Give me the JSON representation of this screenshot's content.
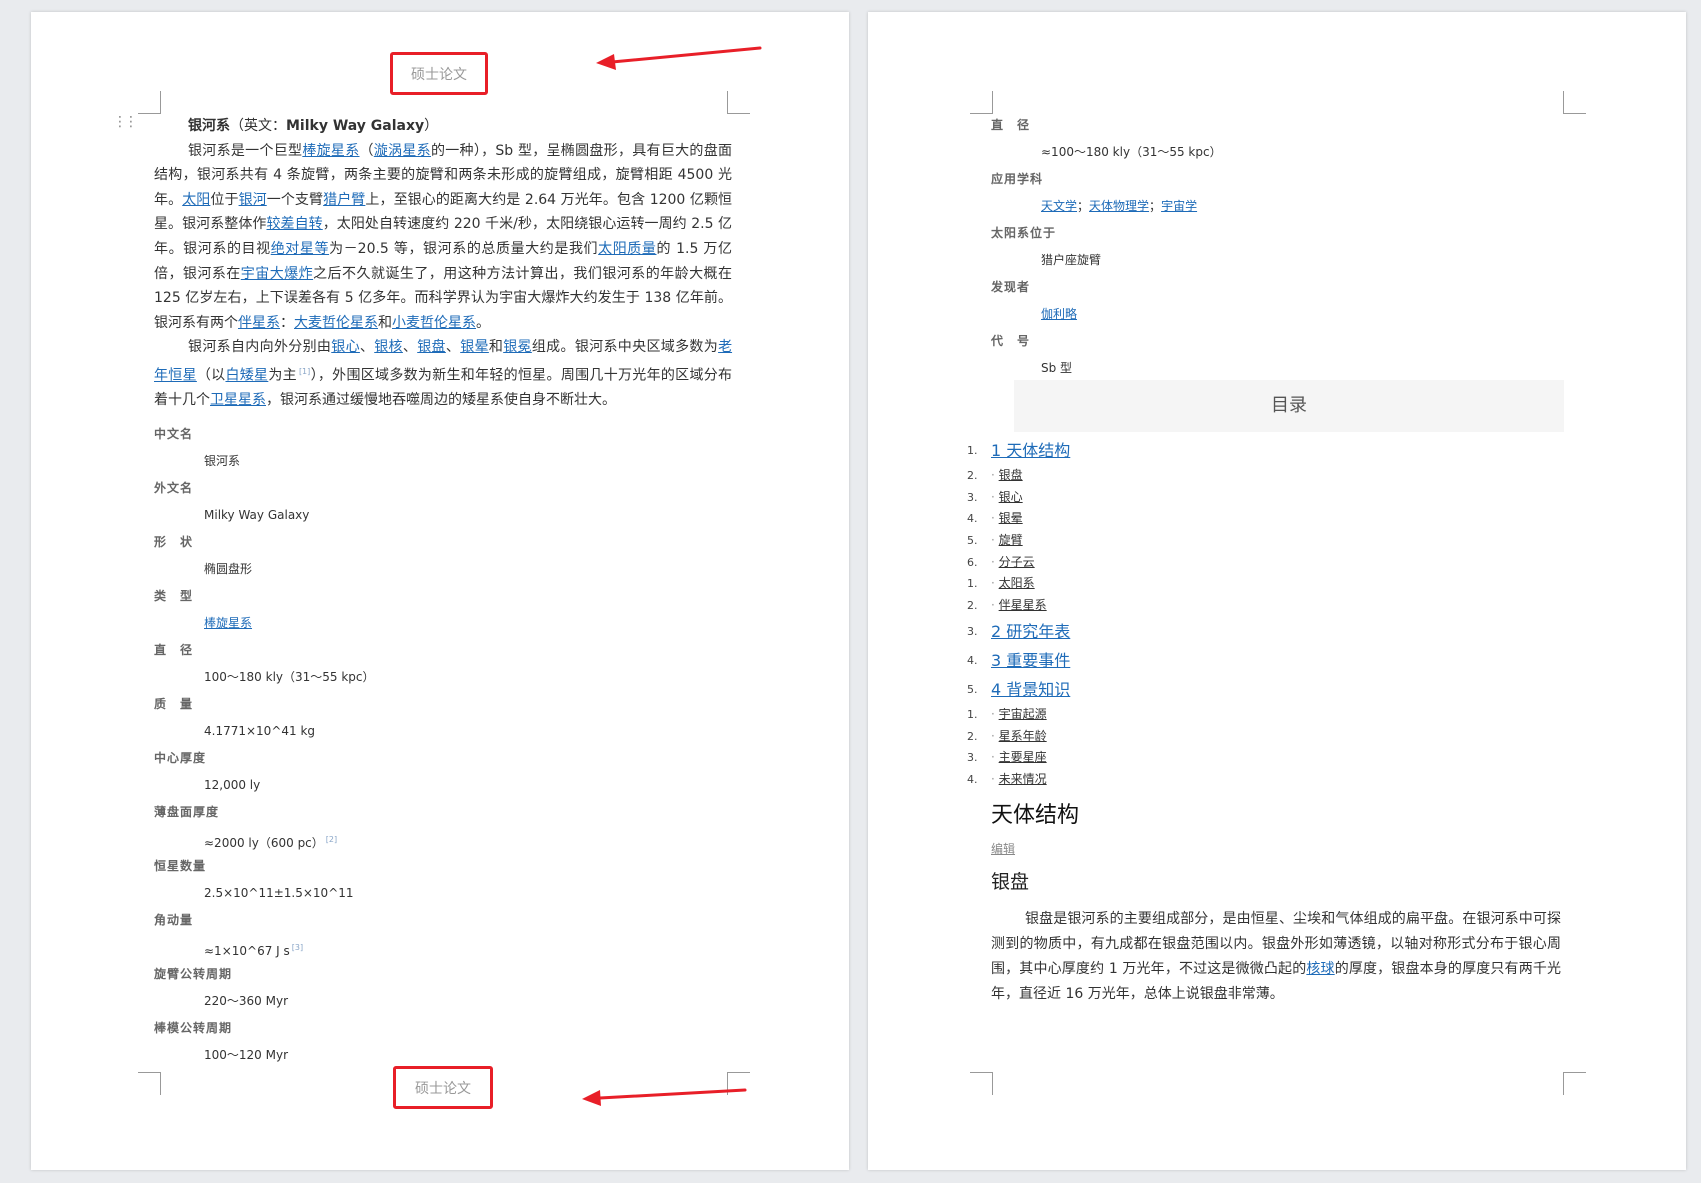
{
  "header_label": "硕士论文",
  "footer_label": "硕士论文",
  "intro": {
    "title_bold": "银河系",
    "title_rest": "（英文：",
    "title_en": "Milky Way Galaxy",
    "title_close": "）",
    "p1": [
      {
        "t": "银河系是一个巨型"
      },
      {
        "t": "棒旋星系",
        "link": true
      },
      {
        "t": "（"
      },
      {
        "t": "漩涡星系",
        "link": true
      },
      {
        "t": "的一种），Sb 型，呈椭圆盘形，具有巨大的盘面结构，银河系共有 4 条旋臂，两条主要的旋臂和两条未形成的旋臂组成，旋臂相距 4500 光年。"
      },
      {
        "t": "太阳",
        "link": true
      },
      {
        "t": "位于"
      },
      {
        "t": "银河",
        "link": true
      },
      {
        "t": "一个支臂"
      },
      {
        "t": "猎户臂",
        "link": true
      },
      {
        "t": "上，至银心的距离大约是 2.64 万光年。包含 1200 亿颗恒星。银河系整体作"
      },
      {
        "t": "较差自转",
        "link": true
      },
      {
        "t": "，太阳处自转速度约 220 千米/秒，太阳绕银心运转一周约 2.5 亿年。银河系的目视"
      },
      {
        "t": "绝对星等",
        "link": true
      },
      {
        "t": "为－20.5 等，银河系的总质量大约是我们"
      },
      {
        "t": "太阳质量",
        "link": true
      },
      {
        "t": "的 1.5 万亿倍，银河系在"
      },
      {
        "t": "宇宙大爆炸",
        "link": true
      },
      {
        "t": "之后不久就诞生了，用这种方法计算出，我们银河系的年龄大概在 125 亿岁左右，上下误差各有 5 亿多年。而科学界认为宇宙大爆炸大约发生于 138 亿年前。银河系有两个"
      },
      {
        "t": "伴星系",
        "link": true
      },
      {
        "t": "："
      },
      {
        "t": "大麦哲伦星系",
        "link": true
      },
      {
        "t": "和"
      },
      {
        "t": "小麦哲伦星系",
        "link": true
      },
      {
        "t": "。"
      }
    ],
    "p2": [
      {
        "t": "银河系自内向外分别由"
      },
      {
        "t": "银心",
        "link": true
      },
      {
        "t": "、"
      },
      {
        "t": "银核",
        "link": true
      },
      {
        "t": "、"
      },
      {
        "t": "银盘",
        "link": true
      },
      {
        "t": "、"
      },
      {
        "t": "银晕",
        "link": true
      },
      {
        "t": "和"
      },
      {
        "t": "银冕",
        "link": true
      },
      {
        "t": "组成。银河系中央区域多数为"
      },
      {
        "t": "老年恒星",
        "link": true
      },
      {
        "t": "（以"
      },
      {
        "t": "白矮星",
        "link": true
      },
      {
        "t": "为主"
      },
      {
        "t": "[1]",
        "sup": true
      },
      {
        "t": "），外围区域多数为新生和年轻的恒星。周围几十万光年的区域分布着十几个"
      },
      {
        "t": "卫星星系",
        "link": true
      },
      {
        "t": "，银河系通过缓慢地吞噬周边的矮星系使自身不断壮大。"
      }
    ]
  },
  "info_left": [
    {
      "label": "中文名",
      "value": "银河系"
    },
    {
      "label": "外文名",
      "value": "Milky  Way  Galaxy"
    },
    {
      "label": "形　状",
      "value": "椭圆盘形"
    },
    {
      "label": "类　型",
      "value": "棒旋星系",
      "link": true
    },
    {
      "label": "直　径",
      "value": "100～180  kly（31～55  kpc）"
    },
    {
      "label": "质　量",
      "value": "4.1771×10^41  kg"
    },
    {
      "label": "中心厚度",
      "value": "12,000  ly"
    },
    {
      "label": "薄盘面厚度",
      "value": "≈2000  ly（600  pc）",
      "sup": "[2]"
    },
    {
      "label": "恒星数量",
      "value": "2.5×10^11±1.5×10^11"
    },
    {
      "label": "角动量",
      "value": "≈1×10^67  J  s",
      "sup": "[3]"
    },
    {
      "label": "旋臂公转周期",
      "value": "220～360  Myr"
    },
    {
      "label": "棒模公转周期",
      "value": "100～120  Myr"
    }
  ],
  "info_right": [
    {
      "label": "直　径",
      "value": "≈100～180  kly（31～55  kpc）"
    },
    {
      "label": "应用学科",
      "links": [
        "天文学",
        "天体物理学",
        "宇宙学"
      ]
    },
    {
      "label": "太阳系位于",
      "value": "猎户座旋臂"
    },
    {
      "label": "发现者",
      "value": "伽利略",
      "link": true
    },
    {
      "label": "代　号",
      "value": "Sb 型"
    }
  ],
  "toc": {
    "title": "目录",
    "items": [
      {
        "num": "1.",
        "text": "1 天体结构",
        "main": true
      },
      {
        "num": "2.",
        "text": "银盘"
      },
      {
        "num": "3.",
        "text": "银心"
      },
      {
        "num": "4.",
        "text": "银晕"
      },
      {
        "num": "5.",
        "text": "旋臂"
      },
      {
        "num": "6.",
        "text": "分子云"
      },
      {
        "num": "1.",
        "text": "太阳系"
      },
      {
        "num": "2.",
        "text": "伴星星系"
      },
      {
        "num": "3.",
        "text": "2 研究年表",
        "main": true
      },
      {
        "num": "4.",
        "text": "3 重要事件",
        "main": true
      },
      {
        "num": "5.",
        "text": "4 背景知识",
        "main": true
      },
      {
        "num": "1.",
        "text": "宇宙起源"
      },
      {
        "num": "2.",
        "text": "星系年龄"
      },
      {
        "num": "3.",
        "text": "主要星座"
      },
      {
        "num": "4.",
        "text": "未来情况"
      }
    ]
  },
  "section": {
    "h1": "天体结构",
    "edit": "编辑",
    "h2": "银盘",
    "para": [
      {
        "t": "银盘是银河系的主要组成部分，是由恒星、尘埃和气体组成的扁平盘。在银河系中可探测到的物质中，有九成都在银盘范围以内。银盘外形如薄透镜，以轴对称形式分布于银心周围，其中心厚度约 1 万光年，不过这是微微凸起的"
      },
      {
        "t": "核球",
        "link": true
      },
      {
        "t": "的厚度，银盘本身的厚度只有两千光年，直径近 16 万光年，总体上说银盘非常薄。"
      }
    ]
  },
  "colors": {
    "link": "#1e6bb8",
    "highlight_box": "#e81f28",
    "arrow": "#e81f28"
  }
}
